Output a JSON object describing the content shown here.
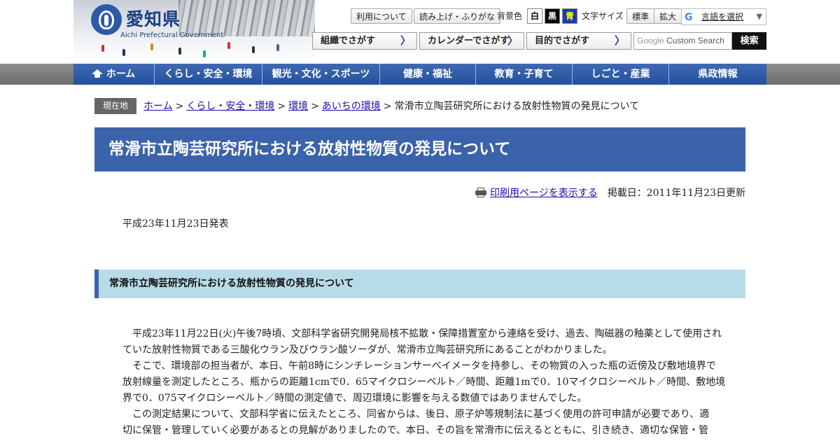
{
  "site": {
    "name_ja": "愛知県",
    "name_en": "Aichi Prefectural Government"
  },
  "utility": {
    "usage": "利用について",
    "reading": "読み上げ・ふりがな",
    "bg_color_label": "背景色",
    "bg_white": "白",
    "bg_black": "黒",
    "bg_blue": "青",
    "font_size_label": "文字サイズ",
    "font_standard": "標準",
    "font_large": "拡大",
    "language_select": "言語を選択",
    "language_arrow": "▼",
    "google_g": "G"
  },
  "search_by": {
    "org": "組織でさがす",
    "calendar": "カレンダーでさがす",
    "purpose": "目的でさがす",
    "chevron": "〉"
  },
  "search": {
    "google_label": "Google",
    "placeholder": "Custom Search",
    "button": "検索"
  },
  "global_nav": [
    "ホーム",
    "くらし・安全・環境",
    "観光・文化・スポーツ",
    "健康・福祉",
    "教育・子育て",
    "しごと・産業",
    "県政情報"
  ],
  "breadcrumb": {
    "label": "現在地",
    "links": [
      "ホーム",
      "くらし・安全・環境",
      "環境",
      "あいちの環境"
    ],
    "separator": ">",
    "current": "常滑市立陶芸研究所における放射性物質の発見について"
  },
  "page": {
    "title": "常滑市立陶芸研究所における放射性物質の発見について",
    "print_link": "印刷用ページを表示する",
    "published": "掲載日：2011年11月23日更新",
    "announce_date": "平成23年11月23日発表",
    "section_heading": "常滑市立陶芸研究所における放射性物質の発見について",
    "body_lines": [
      "　平成23年11月22日(火)午後7時頃、文部科学省研究開発局核不拡散・保障措置室から連絡を受け、過去、陶磁器の釉薬として使用され",
      "ていた放射性物質である三酸化ウラン及びウラン酸ソーダが、常滑市立陶芸研究所にあることがわかりました。",
      "　そこで、環境部の担当者が、本日、午前8時にシンチレーションサーベイメータを持参し、その物質の入った瓶の近傍及び敷地境界で",
      "放射線量を測定したところ、瓶からの距離1cmで0．65マイクロシーベルト／時間、距離1mで0．10マイクロシーベルト／時間、敷地境",
      "界で0．075マイクロシーベルト／時間の測定値で、周辺環境に影響を与える数値ではありませんでした。",
      "　この測定結果について、文部科学省に伝えたところ、同省からは、後日、原子炉等規制法に基づく使用の許可申請が必要であり、適",
      "切に保管・管理していく必要があるとの見解がありましたので、本日、その旨を常滑市に伝えるとともに、引き続き、適切な保管・管"
    ]
  },
  "colors": {
    "nav_blue": "#2c58a4",
    "title_bg": "#3b63ac",
    "section_bg": "#b8dbe8",
    "link": "#1a0dab"
  }
}
